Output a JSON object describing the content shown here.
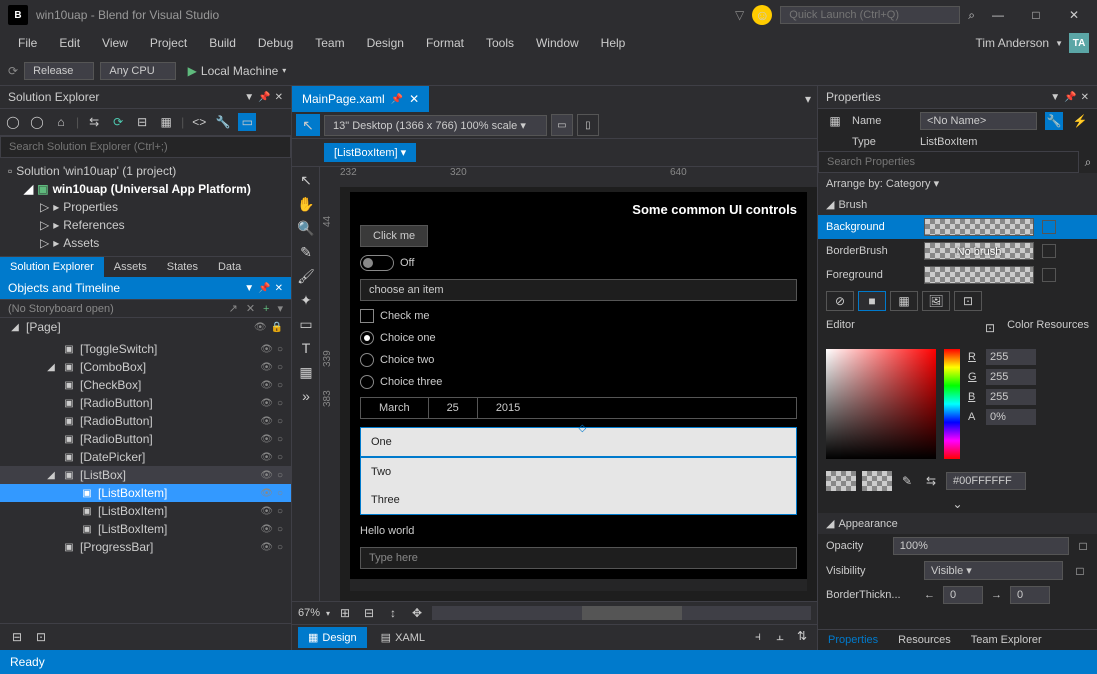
{
  "titlebar": {
    "app_icon": "B",
    "title": "win10uap - Blend for Visual Studio",
    "quicklaunch_placeholder": "Quick Launch (Ctrl+Q)"
  },
  "menubar": {
    "items": [
      "File",
      "Edit",
      "View",
      "Project",
      "Build",
      "Debug",
      "Team",
      "Design",
      "Format",
      "Tools",
      "Window",
      "Help"
    ],
    "user": "Tim Anderson",
    "avatar": "TA"
  },
  "toolbar": {
    "config": "Release",
    "platform": "Any CPU",
    "target": "Local Machine"
  },
  "solexp": {
    "title": "Solution Explorer",
    "search_placeholder": "Search Solution Explorer (Ctrl+;)",
    "solution": "Solution 'win10uap' (1 project)",
    "project": "win10uap (Universal App Platform)",
    "nodes": [
      "Properties",
      "References",
      "Assets"
    ],
    "tabs": [
      "Solution Explorer",
      "Assets",
      "States",
      "Data"
    ]
  },
  "timeline": {
    "title": "Objects and Timeline",
    "storyboard": "(No Storyboard open)",
    "root": "[Page]",
    "items": [
      {
        "label": "[ToggleSwitch]",
        "depth": 2
      },
      {
        "label": "[ComboBox]",
        "depth": 2,
        "expand": true
      },
      {
        "label": "[CheckBox]",
        "depth": 2
      },
      {
        "label": "[RadioButton]",
        "depth": 2
      },
      {
        "label": "[RadioButton]",
        "depth": 2
      },
      {
        "label": "[RadioButton]",
        "depth": 2
      },
      {
        "label": "[DatePicker]",
        "depth": 2
      },
      {
        "label": "[ListBox]",
        "depth": 2,
        "expand": true,
        "selparent": true
      },
      {
        "label": "[ListBoxItem]",
        "depth": 3,
        "selected": true
      },
      {
        "label": "[ListBoxItem]",
        "depth": 3
      },
      {
        "label": "[ListBoxItem]",
        "depth": 3
      },
      {
        "label": "[ProgressBar]",
        "depth": 2
      }
    ]
  },
  "doc": {
    "tab": "MainPage.xaml",
    "device": "13\" Desktop (1366 x 766) 100% scale",
    "breadcrumb": "[ListBoxItem] ▾",
    "ruler_h": [
      "232",
      "320",
      "640"
    ],
    "ruler_v": [
      "44",
      "339",
      "383"
    ],
    "zoom": "67%",
    "design_tab": "Design",
    "xaml_tab": "XAML"
  },
  "mock": {
    "title": "Some common UI controls",
    "button": "Click me",
    "toggle": "Off",
    "combo": "choose an item",
    "check": "Check me",
    "radios": [
      "Choice one",
      "Choice two",
      "Choice three"
    ],
    "date": [
      "March",
      "25",
      "2015"
    ],
    "list": [
      "One",
      "Two",
      "Three"
    ],
    "hello": "Hello world",
    "textbox": "Type here"
  },
  "props": {
    "title": "Properties",
    "name_lbl": "Name",
    "name_val": "<No Name>",
    "type_lbl": "Type",
    "type_val": "ListBoxItem",
    "search_placeholder": "Search Properties",
    "arrange": "Arrange by: Category ▾",
    "cat_brush": "Brush",
    "brushes": [
      {
        "name": "Background",
        "sel": true
      },
      {
        "name": "BorderBrush",
        "val": "No brush"
      },
      {
        "name": "Foreground"
      }
    ],
    "editor_lbl": "Editor",
    "resources_lbl": "Color Resources",
    "rgb": {
      "R": "255",
      "G": "255",
      "B": "255",
      "A": "0%"
    },
    "hex": "#00FFFFFF",
    "cat_appearance": "Appearance",
    "opacity_lbl": "Opacity",
    "opacity": "100%",
    "visibility_lbl": "Visibility",
    "visibility": "Visible",
    "border_lbl": "BorderThickn...",
    "border_l": "0",
    "border_r": "0",
    "tabs": [
      "Properties",
      "Resources",
      "Team Explorer"
    ]
  },
  "status": "Ready"
}
